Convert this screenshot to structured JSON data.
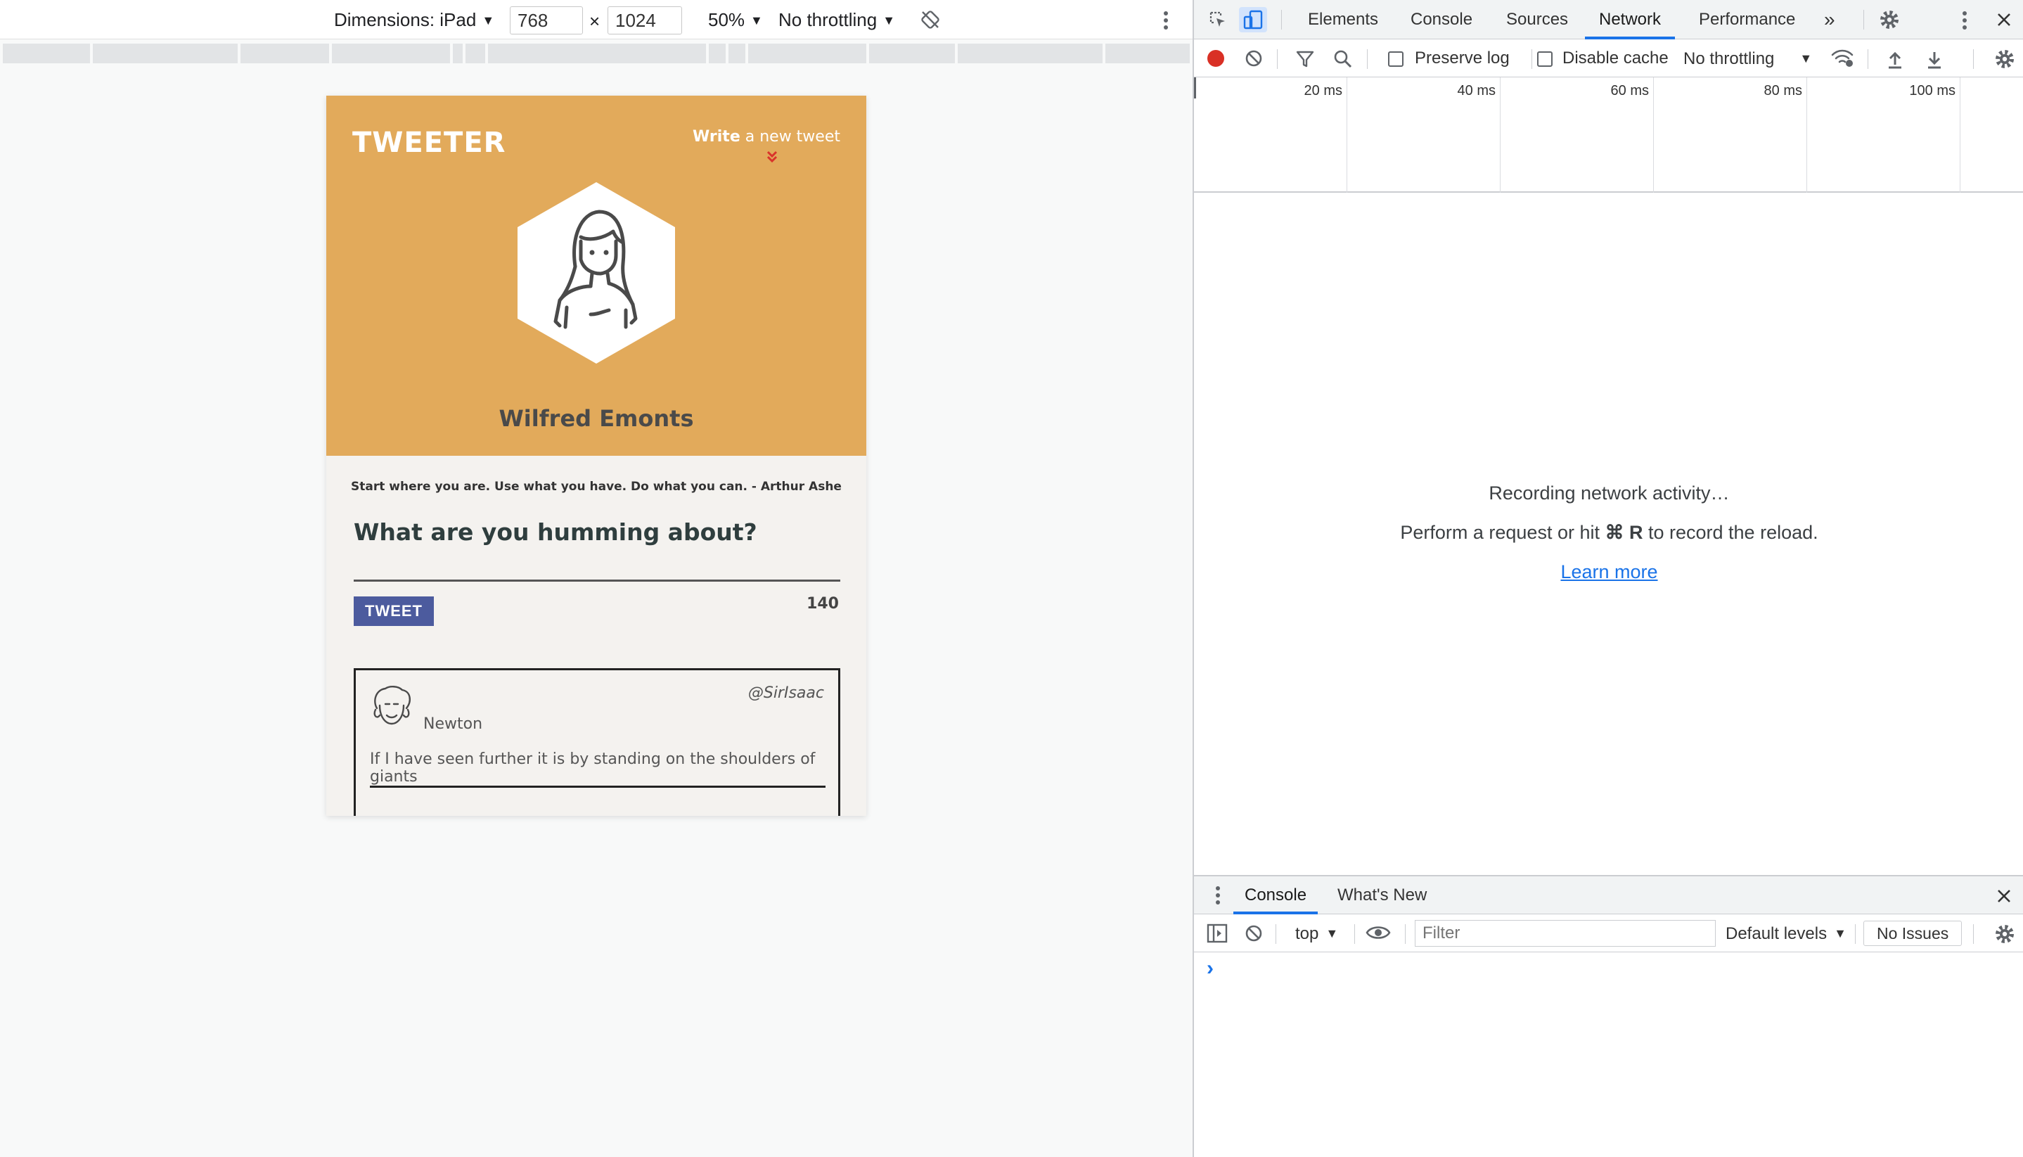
{
  "device_toolbar": {
    "dimensions_label": "Dimensions: iPad",
    "width_value": "768",
    "times": "×",
    "height_value": "1024",
    "zoom": "50%",
    "throttling": "No throttling"
  },
  "page": {
    "brand": "TWEETER",
    "write_bold": "Write",
    "write_rest": " a new tweet",
    "user_name": "Wilfred Emonts",
    "quote": "Start where you are. Use what you have. Do what you can. - Arthur Ashe",
    "compose_prompt": "What are you humming about?",
    "tweet_button": "TWEET",
    "char_count": "140",
    "tweet": {
      "name": "Newton",
      "handle": "@SirIsaac",
      "body": "If I have seen further it is by standing on the shoulders of giants"
    }
  },
  "devtools": {
    "tabs": [
      "Elements",
      "Console",
      "Sources",
      "Network",
      "Performance"
    ],
    "active_tab": "Network",
    "more_tabs": "»",
    "network_toolbar": {
      "preserve_log": "Preserve log",
      "disable_cache": "Disable cache",
      "throttling": "No throttling"
    },
    "timeline_labels": [
      "20 ms",
      "40 ms",
      "60 ms",
      "80 ms",
      "100 ms"
    ],
    "empty_state": {
      "line1": "Recording network activity…",
      "line2_pre": "Perform a request or hit ",
      "line2_key": "⌘ R",
      "line2_post": " to record the reload.",
      "link": "Learn more"
    },
    "drawer": {
      "tabs": [
        "Console",
        "What's New"
      ],
      "context": "top",
      "filter_placeholder": "Filter",
      "levels": "Default levels",
      "issues": "No Issues",
      "prompt": "›"
    }
  },
  "colors": {
    "hero": "#e2aa5b",
    "tweet_button": "#4c5b9e",
    "accent": "#1a73e8",
    "record": "#d93025"
  }
}
